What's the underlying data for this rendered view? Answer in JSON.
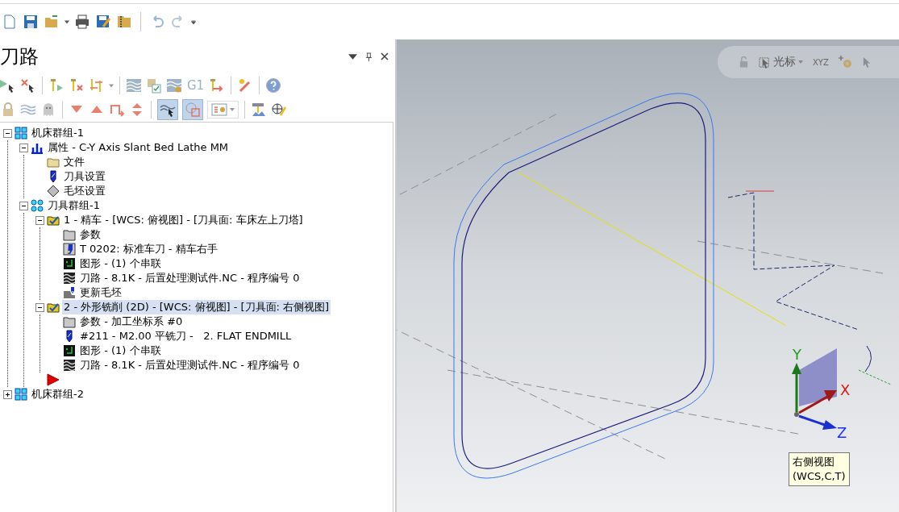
{
  "panel": {
    "title": "刀路"
  },
  "toolbar": {
    "g1_label": "G1",
    "toggles": [
      {
        "selected": true
      },
      {
        "selected": true
      }
    ]
  },
  "tree": [
    {
      "kind": "machine_group",
      "label": "机床群组-1",
      "expanded": true,
      "selected": false,
      "children": [
        {
          "kind": "properties",
          "label": "属性 - C-Y Axis Slant Bed Lathe MM",
          "expanded": true,
          "selected": false,
          "children": [
            {
              "kind": "folder",
              "label": "文件",
              "selected": false
            },
            {
              "kind": "tool",
              "label": "刀具设置",
              "selected": false
            },
            {
              "kind": "stock",
              "label": "毛坯设置",
              "selected": false
            }
          ]
        },
        {
          "kind": "tool_group",
          "label": "刀具群组-1",
          "expanded": true,
          "selected": false,
          "children": [
            {
              "kind": "operation",
              "label": "1 - 精车 - [WCS: 俯视图] - [刀具面: 车床左上刀塔]",
              "expanded": true,
              "selected": false,
              "children": [
                {
                  "kind": "params",
                  "label": "参数",
                  "selected": false
                },
                {
                  "kind": "lathe_tool",
                  "label": "T 0202: 标准车刀 - 精车右手",
                  "selected": false
                },
                {
                  "kind": "geometry",
                  "label": "图形 - (1) 个串联",
                  "selected": false
                },
                {
                  "kind": "toolpath",
                  "label": "刀路 - 8.1K - 后置处理测试件.NC - 程序编号 0",
                  "selected": false
                },
                {
                  "kind": "stock_update",
                  "label": "更新毛坯",
                  "selected": false
                }
              ]
            },
            {
              "kind": "operation",
              "label": "2 - 外形铣削 (2D) - [WCS: 俯视图] - [刀具面: 右侧视图]",
              "expanded": true,
              "selected": true,
              "children": [
                {
                  "kind": "params",
                  "label": "参数 - 加工坐标系 #0",
                  "selected": false
                },
                {
                  "kind": "mill_tool",
                  "label": "#211 - M2.00 平铣刀 -   2. FLAT ENDMILL",
                  "selected": false
                },
                {
                  "kind": "geometry",
                  "label": "图形 - (1) 个串联",
                  "selected": false
                },
                {
                  "kind": "toolpath",
                  "label": "刀路 - 8.1K - 后置处理测试件.NC - 程序编号 0",
                  "selected": false
                }
              ]
            },
            {
              "kind": "insert_marker",
              "selected": false
            }
          ]
        }
      ]
    },
    {
      "kind": "machine_group",
      "label": "机床群组-2",
      "expanded": false,
      "selected": false
    }
  ],
  "viewport": {
    "toolbar": {
      "mode_label": "光标",
      "coords_label": "XYZ"
    },
    "axes": {
      "x": "X",
      "y": "Y",
      "z": "Z"
    },
    "tooltip": {
      "lines": [
        "右侧视图",
        "(WCS,C,T)"
      ]
    }
  }
}
